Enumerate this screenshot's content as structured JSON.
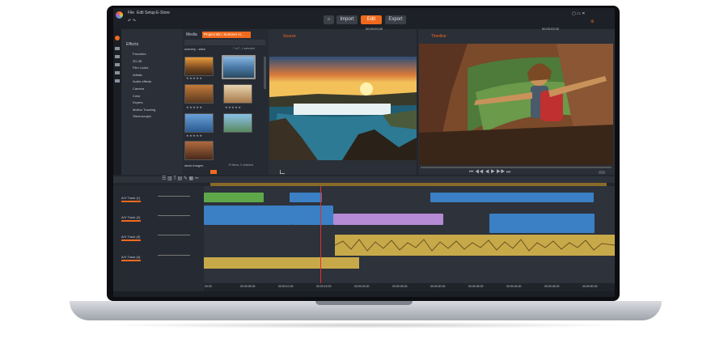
{
  "menu": {
    "items": [
      "File",
      "Edit",
      "Setup",
      "E-Store"
    ]
  },
  "modes": {
    "home_icon": "home-icon",
    "tabs": [
      "Import",
      "Edit",
      "Export"
    ],
    "active": "Edit"
  },
  "timecode_left": "00:00:03.00",
  "timecode_right": "00:00:03.00",
  "library": {
    "tab_effects": "Effects",
    "tab_media": "Media",
    "project_tab": "Project Bin: Summer H...",
    "folder_label": "scenery - sites",
    "folder_count": "7 of 7, 1 selected",
    "categories": [
      "Favorites",
      "2D-3D",
      "Film Looks",
      "Artistic",
      "Audio effects",
      "Camera",
      "Color",
      "Keyers",
      "Motion Tracking",
      "Stereoscopic"
    ],
    "stock_label": "stock images",
    "stock_count": "75 items, 0 selected"
  },
  "preview": {
    "source_label": "Source",
    "timeline_label": "Timeline"
  },
  "tracks": [
    {
      "name": "A/V Track (1)"
    },
    {
      "name": "A/V Track (2)"
    },
    {
      "name": "A/V Track (3)"
    },
    {
      "name": "A/V Track (4)"
    }
  ],
  "ruler": [
    "00:00",
    "00:00:05.00",
    "00:00:10.00",
    "00:00:15.00",
    "00:00:20.00",
    "00:00:25.00",
    "00:00:30.00",
    "00:00:35.00",
    "00:00:40.00",
    "00:00:45.00",
    "00:00:50.00"
  ],
  "colors": {
    "accent": "#f06a1e",
    "clip_blue": "#3b7fc4",
    "clip_green": "#5fa84a",
    "clip_purple": "#b58ad4",
    "clip_gold": "#c8a94a",
    "panel": "#2b2f37"
  }
}
